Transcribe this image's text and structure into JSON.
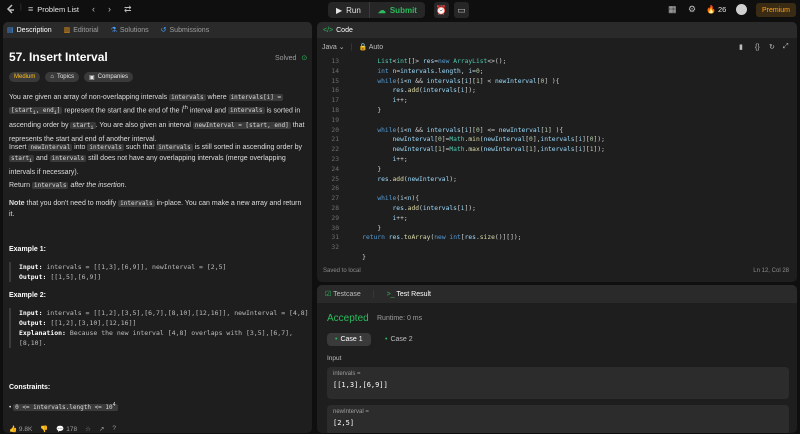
{
  "topbar": {
    "problem_list": "Problem List",
    "run": "Run",
    "submit": "Submit",
    "streak": "26",
    "premium": "Premium"
  },
  "left": {
    "tabs": [
      "Description",
      "Editorial",
      "Solutions",
      "Submissions"
    ],
    "title": "57. Insert Interval",
    "solved": "Solved",
    "chips": [
      "Medium",
      "Topics",
      "Companies"
    ],
    "footer": {
      "likes": "9.8K",
      "comments": "178"
    }
  },
  "editor": {
    "header": "Code",
    "language": "Java",
    "auto": "Auto",
    "saved": "Saved to local",
    "cursor": "Ln 12, Col 28",
    "line_numbers": [
      "13",
      "14",
      "15",
      "16",
      "17",
      "18",
      "19",
      "20",
      "21",
      "22",
      "23",
      "24",
      "25",
      "26",
      "27",
      "28",
      "29",
      "30",
      "31",
      "32"
    ]
  },
  "test": {
    "tabs": [
      "Testcase",
      "Test Result"
    ],
    "accepted": "Accepted",
    "runtime": "Runtime: 0 ms",
    "cases": [
      "Case 1",
      "Case 2"
    ],
    "input_label": "Input",
    "field1_label": "intervals =",
    "field1_value": "[[1,3],[6,9]]",
    "field2_label": "newInterval =",
    "field2_value": "[2,5]"
  }
}
